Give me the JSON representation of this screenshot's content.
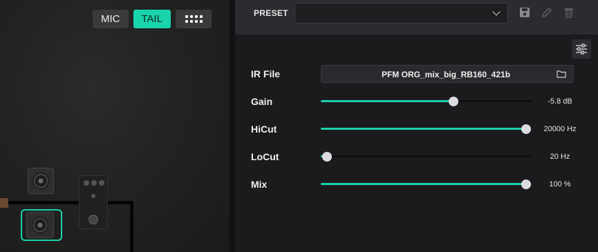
{
  "canvas": {
    "buttons": [
      {
        "label": "MIC",
        "active": false
      },
      {
        "label": "TAIL",
        "active": true
      }
    ],
    "grid_icon": "grid-icon"
  },
  "preset": {
    "label": "PRESET",
    "selected": "",
    "icons": [
      "save-icon",
      "edit-icon",
      "trash-icon"
    ]
  },
  "params": {
    "ir_file": {
      "label": "IR File",
      "value": "PFM ORG_mix_big_RB160_421b",
      "icon": "folder-icon"
    },
    "gain": {
      "label": "Gain",
      "value": "-5.8 dB",
      "fraction": 0.63
    },
    "hicut": {
      "label": "HiCut",
      "value": "20000 Hz",
      "fraction": 0.975
    },
    "locut": {
      "label": "LoCut",
      "value": "20 Hz",
      "fraction": 0.03
    },
    "mix": {
      "label": "Mix",
      "value": "100 %",
      "fraction": 0.975
    }
  },
  "colors": {
    "accent": "#19d3ad"
  }
}
